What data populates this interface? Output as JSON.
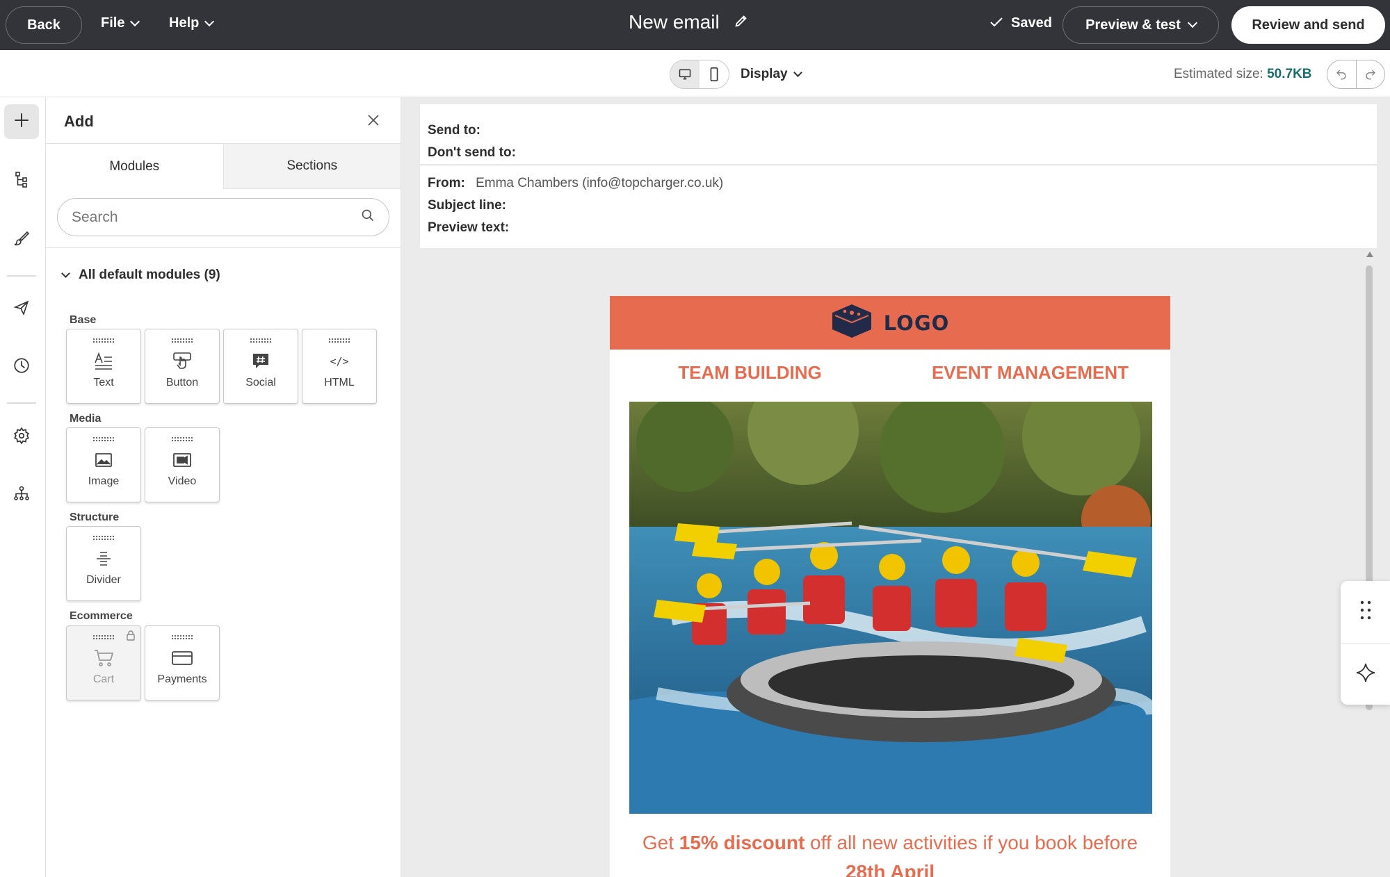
{
  "topbar": {
    "back_label": "Back",
    "file_label": "File",
    "help_label": "Help",
    "title": "New email",
    "saved_label": "Saved",
    "preview_label": "Preview & test",
    "review_label": "Review and send",
    "background": "#33333a"
  },
  "subbar": {
    "display_label": "Display",
    "estimated_label": "Estimated size:",
    "estimated_value": "50.7KB",
    "estimated_color": "#1a6e6a"
  },
  "rail": {
    "items": [
      {
        "icon": "plus-icon",
        "active": true
      },
      {
        "icon": "tree-structure-icon"
      },
      {
        "icon": "brush-icon"
      },
      {
        "icon": "send-icon"
      },
      {
        "icon": "clock-icon"
      },
      {
        "icon": "gear-icon"
      },
      {
        "icon": "hierarchy-icon"
      }
    ]
  },
  "panel": {
    "title": "Add",
    "tabs": [
      {
        "label": "Modules",
        "active": true
      },
      {
        "label": "Sections",
        "active": false
      }
    ],
    "search": {
      "placeholder": "Search",
      "value": ""
    },
    "group_label": "All default modules (9)",
    "categories": {
      "base": "Base",
      "media": "Media",
      "structure": "Structure",
      "ecommerce": "Ecommerce"
    },
    "modules": {
      "text": "Text",
      "button": "Button",
      "social": "Social",
      "html": "HTML",
      "image": "Image",
      "video": "Video",
      "divider": "Divider",
      "cart": "Cart",
      "payments": "Payments"
    },
    "html_icon_text": "</>"
  },
  "meta": {
    "send_to_label": "Send to:",
    "dont_send_label": "Don't send to:",
    "from_label": "From:",
    "from_value": "Emma Chambers (info@topcharger.co.uk)",
    "subject_label": "Subject line:",
    "preview_label": "Preview text:"
  },
  "email": {
    "logo_text": "LOGO",
    "nav": [
      "TEAM BUILDING",
      "EVENT MANAGEMENT"
    ],
    "offer_pre": "Get ",
    "offer_bold": "15% discount",
    "offer_post": " off all new activities if you book before",
    "offer_date": "28th April",
    "brand_color": "#e76c4f",
    "logo_color": "#222a4a"
  }
}
